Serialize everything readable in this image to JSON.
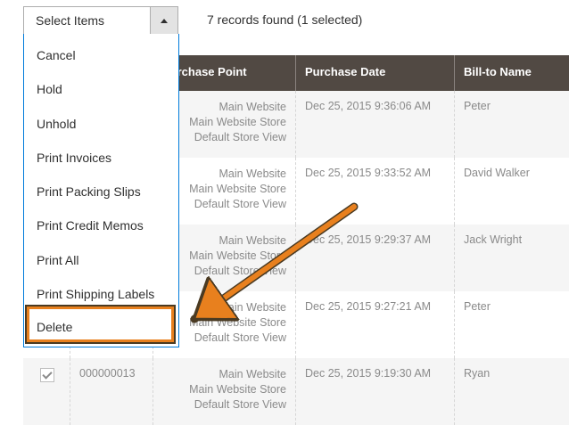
{
  "toolbar": {
    "select_label": "Select Items",
    "records_text": "7 records found (1 selected)"
  },
  "actions_menu": {
    "items": [
      "Cancel",
      "Hold",
      "Unhold",
      "Print Invoices",
      "Print Packing Slips",
      "Print Credit Memos",
      "Print All",
      "Print Shipping Labels"
    ],
    "highlighted_item": "Delete"
  },
  "grid": {
    "headers": [
      "",
      "",
      "Purchase Point",
      "Purchase Date",
      "Bill-to Name"
    ],
    "rows": [
      {
        "checked": false,
        "id": "",
        "purchase_point": [
          "Main Website",
          "Main Website Store",
          "Default Store View"
        ],
        "date": "Dec 25, 2015 9:36:06 AM",
        "bill_to": "Peter"
      },
      {
        "checked": false,
        "id": "",
        "purchase_point": [
          "Main Website",
          "Main Website Store",
          "Default Store View"
        ],
        "date": "Dec 25, 2015 9:33:52 AM",
        "bill_to": "David Walker"
      },
      {
        "checked": false,
        "id": "",
        "purchase_point": [
          "Main Website",
          "Main Website Store",
          "Default Store View"
        ],
        "date": "Dec 25, 2015 9:29:37 AM",
        "bill_to": "Jack Wright"
      },
      {
        "checked": false,
        "id": "",
        "purchase_point": [
          "Main Website",
          "Main Website Store",
          "Default Store View"
        ],
        "date": "Dec 25, 2015 9:27:21 AM",
        "bill_to": "Peter"
      },
      {
        "checked": true,
        "id": "000000013",
        "purchase_point": [
          "Main Website",
          "Main Website Store",
          "Default Store View"
        ],
        "date": "Dec 25, 2015 9:19:30 AM",
        "bill_to": "Ryan"
      }
    ]
  },
  "colors": {
    "header_bg": "#514943",
    "highlight": "#e8801e",
    "menu_border": "#007bdb"
  }
}
